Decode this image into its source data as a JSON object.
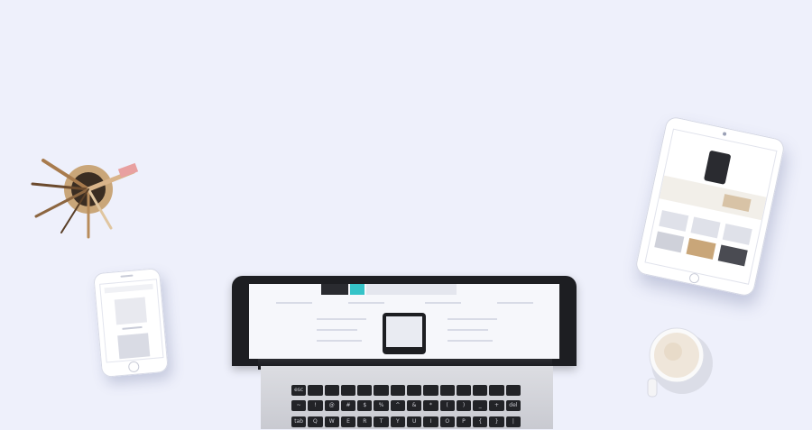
{
  "scene": {
    "background_color": "#eef0fb",
    "objects": [
      "brush-cup",
      "smartphone",
      "tablet",
      "laptop",
      "coffee-cup"
    ]
  },
  "laptop": {
    "keyboard_row_fn": [
      "esc",
      "",
      "",
      "",
      "",
      "",
      "",
      "",
      "",
      "",
      "",
      "",
      "",
      ""
    ],
    "keyboard_row_num": [
      "~",
      "!",
      "@",
      "#",
      "$",
      "%",
      "^",
      "&",
      "*",
      "(",
      ")",
      "_",
      "+",
      "del"
    ],
    "keyboard_row_top": [
      "tab",
      "Q",
      "W",
      "E",
      "R",
      "T",
      "Y",
      "U",
      "I",
      "O",
      "P",
      "{",
      "}",
      "|"
    ]
  },
  "colors": {
    "laptop_frame": "#1d1e22",
    "accent_teal": "#35c3c8",
    "coffee_foam": "#efe6da"
  }
}
